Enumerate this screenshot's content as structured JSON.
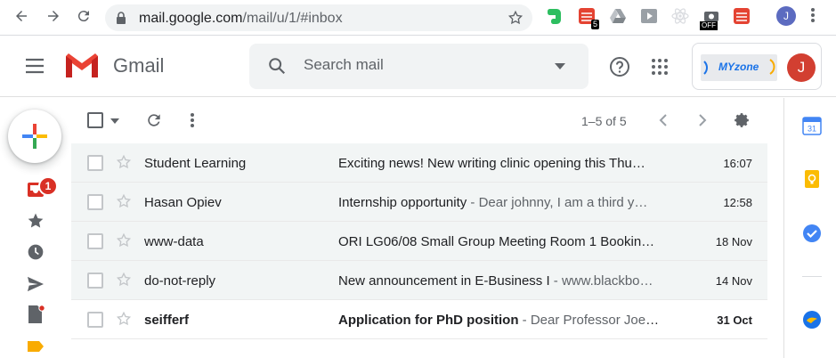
{
  "browser": {
    "url_host": "mail.google.com",
    "url_path": "/mail/u/1/#inbox",
    "ext_badge_count": "5",
    "ext_off_label": "OFF",
    "profile_initial": "J"
  },
  "header": {
    "app_name": "Gmail",
    "search_placeholder": "Search mail",
    "myzone_label": "MYzone",
    "account_initial": "J"
  },
  "sidebar": {
    "inbox_unread": "1"
  },
  "toolbar": {
    "pagination": "1–5 of 5"
  },
  "emails": [
    {
      "sender": "Student Learning",
      "subject": "Exciting news! New writing clinic opening this Thu…",
      "snippet": "",
      "date": "16:07",
      "unread": false
    },
    {
      "sender": "Hasan Opiev",
      "subject": "Internship opportunity",
      "snippet": " - Dear johnny, I am a third y…",
      "date": "12:58",
      "unread": false
    },
    {
      "sender": "www-data",
      "subject": "ORI LG06/08 Small Group Meeting Room 1 Bookin…",
      "snippet": "",
      "date": "18 Nov",
      "unread": false
    },
    {
      "sender": "do-not-reply",
      "subject": "New announcement in E-Business I",
      "snippet": " - www.blackbo…",
      "date": "14 Nov",
      "unread": false
    },
    {
      "sender": "seifferf",
      "subject": "Application for PhD position",
      "snippet": " - Dear Professor Joer…",
      "date": "31 Oct",
      "unread": true
    }
  ],
  "colors": {
    "gmail_red": "#EA4335",
    "unread_badge": "#d93025",
    "read_row_bg": "#f2f5f5"
  }
}
